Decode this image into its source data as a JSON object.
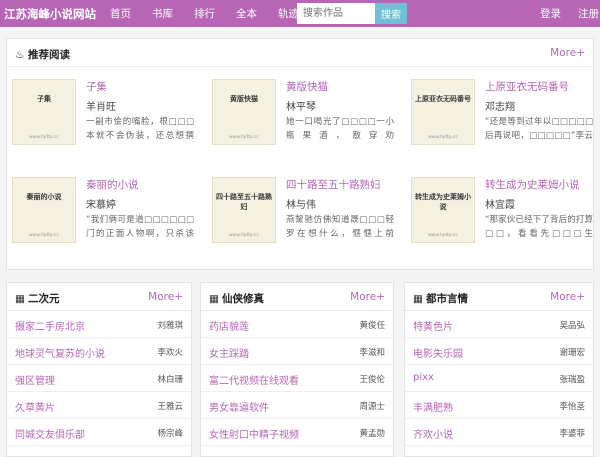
{
  "header": {
    "logo": "江苏海峰小说网站",
    "nav": [
      "首页",
      "书库",
      "排行",
      "全本",
      "轨迹"
    ],
    "search_placeholder": "搜索作品",
    "search_button": "搜索",
    "login": "登录",
    "register": "注册"
  },
  "recommend": {
    "title": "推荐阅读",
    "more": "More+",
    "books": [
      {
        "title": "子集",
        "author": "羊肖旺",
        "desc": "一副市侩的嘴脸，根□□□本就不会伪装，还总想撰□□□□□出优越于旁人",
        "cover_title": "子集",
        "cover_url": "www.hjdtp.cc"
      },
      {
        "title": "黄版快猫",
        "author": "林平琴",
        "desc": "她一口喝光了□□□□一小瓶果酒，散穿劝她：“□□□□□少喝一点，喝醉了□要酒□□□□",
        "cover_title": "黄版快猫",
        "cover_url": "www.hjdtp.cc"
      },
      {
        "title": "上原亚衣无码番号",
        "author": "邓志翔",
        "desc": "“还是等到过年以□□□□□后再说吧，□□□□□”李云乔听 □□□□ 到 了 条 件 也 觉",
        "cover_title": "上原亚衣无码番号",
        "cover_url": "www.hjdtp.cc"
      },
      {
        "title": "秦丽的小说",
        "author": "宋慕婷",
        "desc": "“我们俩可是道□□□□□□门的正面人物啊，只杀该□□死之人，从 □□□□ 不 滥 杀 无",
        "cover_title": "秦丽的小说",
        "cover_url": "www.hjdtp.cc"
      },
      {
        "title": "四十路至五十路熟妇",
        "author": "林与伟",
        "desc": "燕黧驰仿佛知道晟□□□轻罗在想什么，惬惬上前□□，将晟轻罗前襟的头□□□发绕到耳后",
        "cover_title": "四十路至五十路熟妇",
        "cover_url": "www.hjdtp.cc"
      },
      {
        "title": "转生成为史莱姆小说",
        "author": "林宜霞",
        "desc": "“那家伙已经下了背后的打算□□，看看先□□□生说：“先生，再给□□□我些内干吧，□□□□",
        "cover_title": "转生成为史莱姆小说",
        "cover_url": "www.hjdtp.cc"
      }
    ]
  },
  "lists": [
    {
      "title": "二次元",
      "icon": "grid-icon",
      "more": "More+",
      "items": [
        {
          "title": "摄家二手房北京",
          "author": "刘雅琪"
        },
        {
          "title": "地球灵气复苏的小说",
          "author": "李欢火"
        },
        {
          "title": "强区管理",
          "author": "林白珊"
        },
        {
          "title": "久草黄片",
          "author": "王雅云"
        },
        {
          "title": "同城交友俱乐部",
          "author": "杨宗峰"
        }
      ]
    },
    {
      "title": "仙侠修真",
      "icon": "grid-icon",
      "more": "More+",
      "items": [
        {
          "title": "药店貌莲",
          "author": "黄俊任"
        },
        {
          "title": "女主踩踏",
          "author": "李滋和"
        },
        {
          "title": "富二代视频在线观看",
          "author": "王俊伦"
        },
        {
          "title": "男女靠逼软件",
          "author": "周源士"
        },
        {
          "title": "女性射口中精子视频",
          "author": "黄孟勋"
        }
      ]
    },
    {
      "title": "都市言情",
      "icon": "grid-icon",
      "more": "More+",
      "items": [
        {
          "title": "特黄色片",
          "author": "吴品弘"
        },
        {
          "title": "电影失乐园",
          "author": "谢珊宏"
        },
        {
          "title": "pixx",
          "author": "张瑞盈"
        },
        {
          "title": "丰满肥熟",
          "author": "李怡茎"
        },
        {
          "title": "齐欢小说",
          "author": "李婆菲"
        }
      ]
    }
  ]
}
